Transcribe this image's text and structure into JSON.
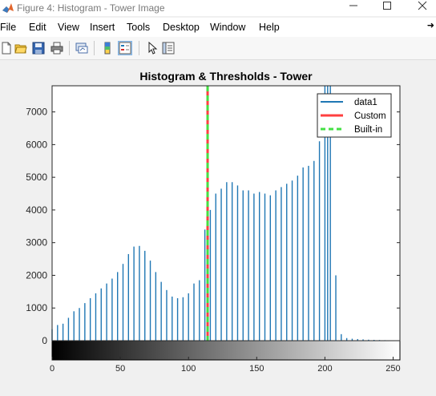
{
  "window": {
    "title": "Figure 4: Histogram - Tower Image",
    "minimize_icon": "minimize-icon",
    "maximize_icon": "maximize-icon",
    "close_icon": "close-icon"
  },
  "menu": {
    "items": [
      "File",
      "Edit",
      "View",
      "Insert",
      "Tools",
      "Desktop",
      "Window",
      "Help"
    ]
  },
  "toolbar": {
    "icons": [
      "new-figure-icon",
      "open-file-icon",
      "save-icon",
      "print-icon",
      "link-plot-icon",
      "insert-colorbar-icon",
      "insert-legend-icon",
      "edit-plot-arrow-icon",
      "property-inspector-icon"
    ]
  },
  "colors": {
    "histogram": "#1f77b4",
    "custom": "#ff4040",
    "builtin": "#44e044"
  },
  "chart_data": {
    "type": "bar",
    "title": "Histogram & Thresholds - Tower",
    "xlabel": "",
    "ylabel": "",
    "xlim": [
      0,
      255
    ],
    "ylim": [
      0,
      7800
    ],
    "xticks": [
      0,
      50,
      100,
      150,
      200,
      250
    ],
    "yticks": [
      0,
      1000,
      2000,
      3000,
      4000,
      5000,
      6000,
      7000
    ],
    "x": [
      0,
      4,
      8,
      12,
      16,
      20,
      24,
      28,
      32,
      36,
      40,
      44,
      48,
      52,
      56,
      60,
      64,
      68,
      72,
      76,
      80,
      84,
      88,
      92,
      96,
      100,
      104,
      108,
      112,
      116,
      120,
      124,
      128,
      132,
      136,
      140,
      144,
      148,
      152,
      156,
      160,
      164,
      168,
      172,
      176,
      180,
      184,
      188,
      192,
      196,
      200,
      202,
      204,
      208,
      212,
      216,
      220,
      224,
      228,
      232,
      236,
      240,
      244,
      248,
      252
    ],
    "values": [
      350,
      480,
      520,
      700,
      900,
      1000,
      1150,
      1300,
      1450,
      1600,
      1750,
      1900,
      2100,
      2350,
      2650,
      2880,
      2900,
      2750,
      2450,
      2100,
      1800,
      1550,
      1350,
      1300,
      1330,
      1450,
      1750,
      1850,
      3400,
      4000,
      4500,
      4650,
      4850,
      4850,
      4750,
      4600,
      4600,
      4500,
      4550,
      4500,
      4450,
      4600,
      4700,
      4800,
      4900,
      5050,
      5300,
      5350,
      5500,
      6100,
      7800,
      7800,
      7800,
      2000,
      200,
      80,
      60,
      50,
      40,
      30,
      25,
      20,
      15,
      10,
      10
    ],
    "thresholds": [
      {
        "name": "Custom",
        "x": 114
      },
      {
        "name": "Built-in",
        "x": 114
      }
    ],
    "legend": {
      "position": "top-right",
      "entries": [
        "data1",
        "Custom",
        "Built-in"
      ]
    },
    "colorbar": "grayscale 0 to 255 along x-axis",
    "grid": false
  }
}
